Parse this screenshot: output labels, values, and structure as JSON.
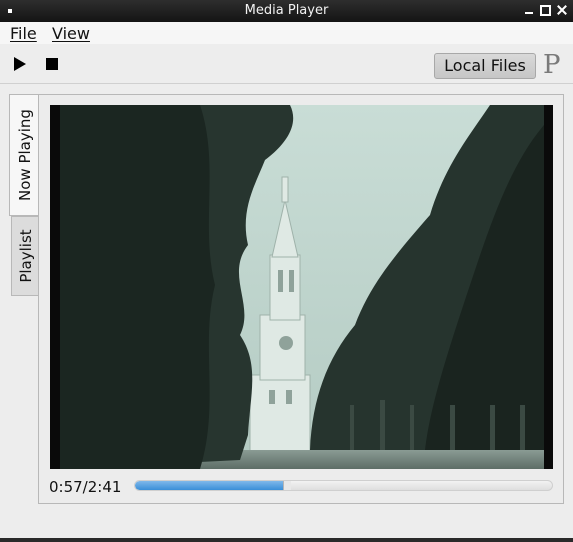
{
  "window": {
    "title": "Media Player"
  },
  "menu": {
    "file": "File",
    "view": "View"
  },
  "toolbar": {
    "play_icon": "play-icon",
    "stop_icon": "stop-icon",
    "local_files_label": "Local Files",
    "logo_text": "P"
  },
  "tabs": [
    {
      "label": "Now Playing",
      "active": true
    },
    {
      "label": "Playlist",
      "active": false
    }
  ],
  "player": {
    "time_display": "0:57/2:41",
    "progress_fraction": 0.354
  },
  "colors": {
    "accent": "#3a8fd8",
    "titlebar": "#1e1e1e"
  }
}
